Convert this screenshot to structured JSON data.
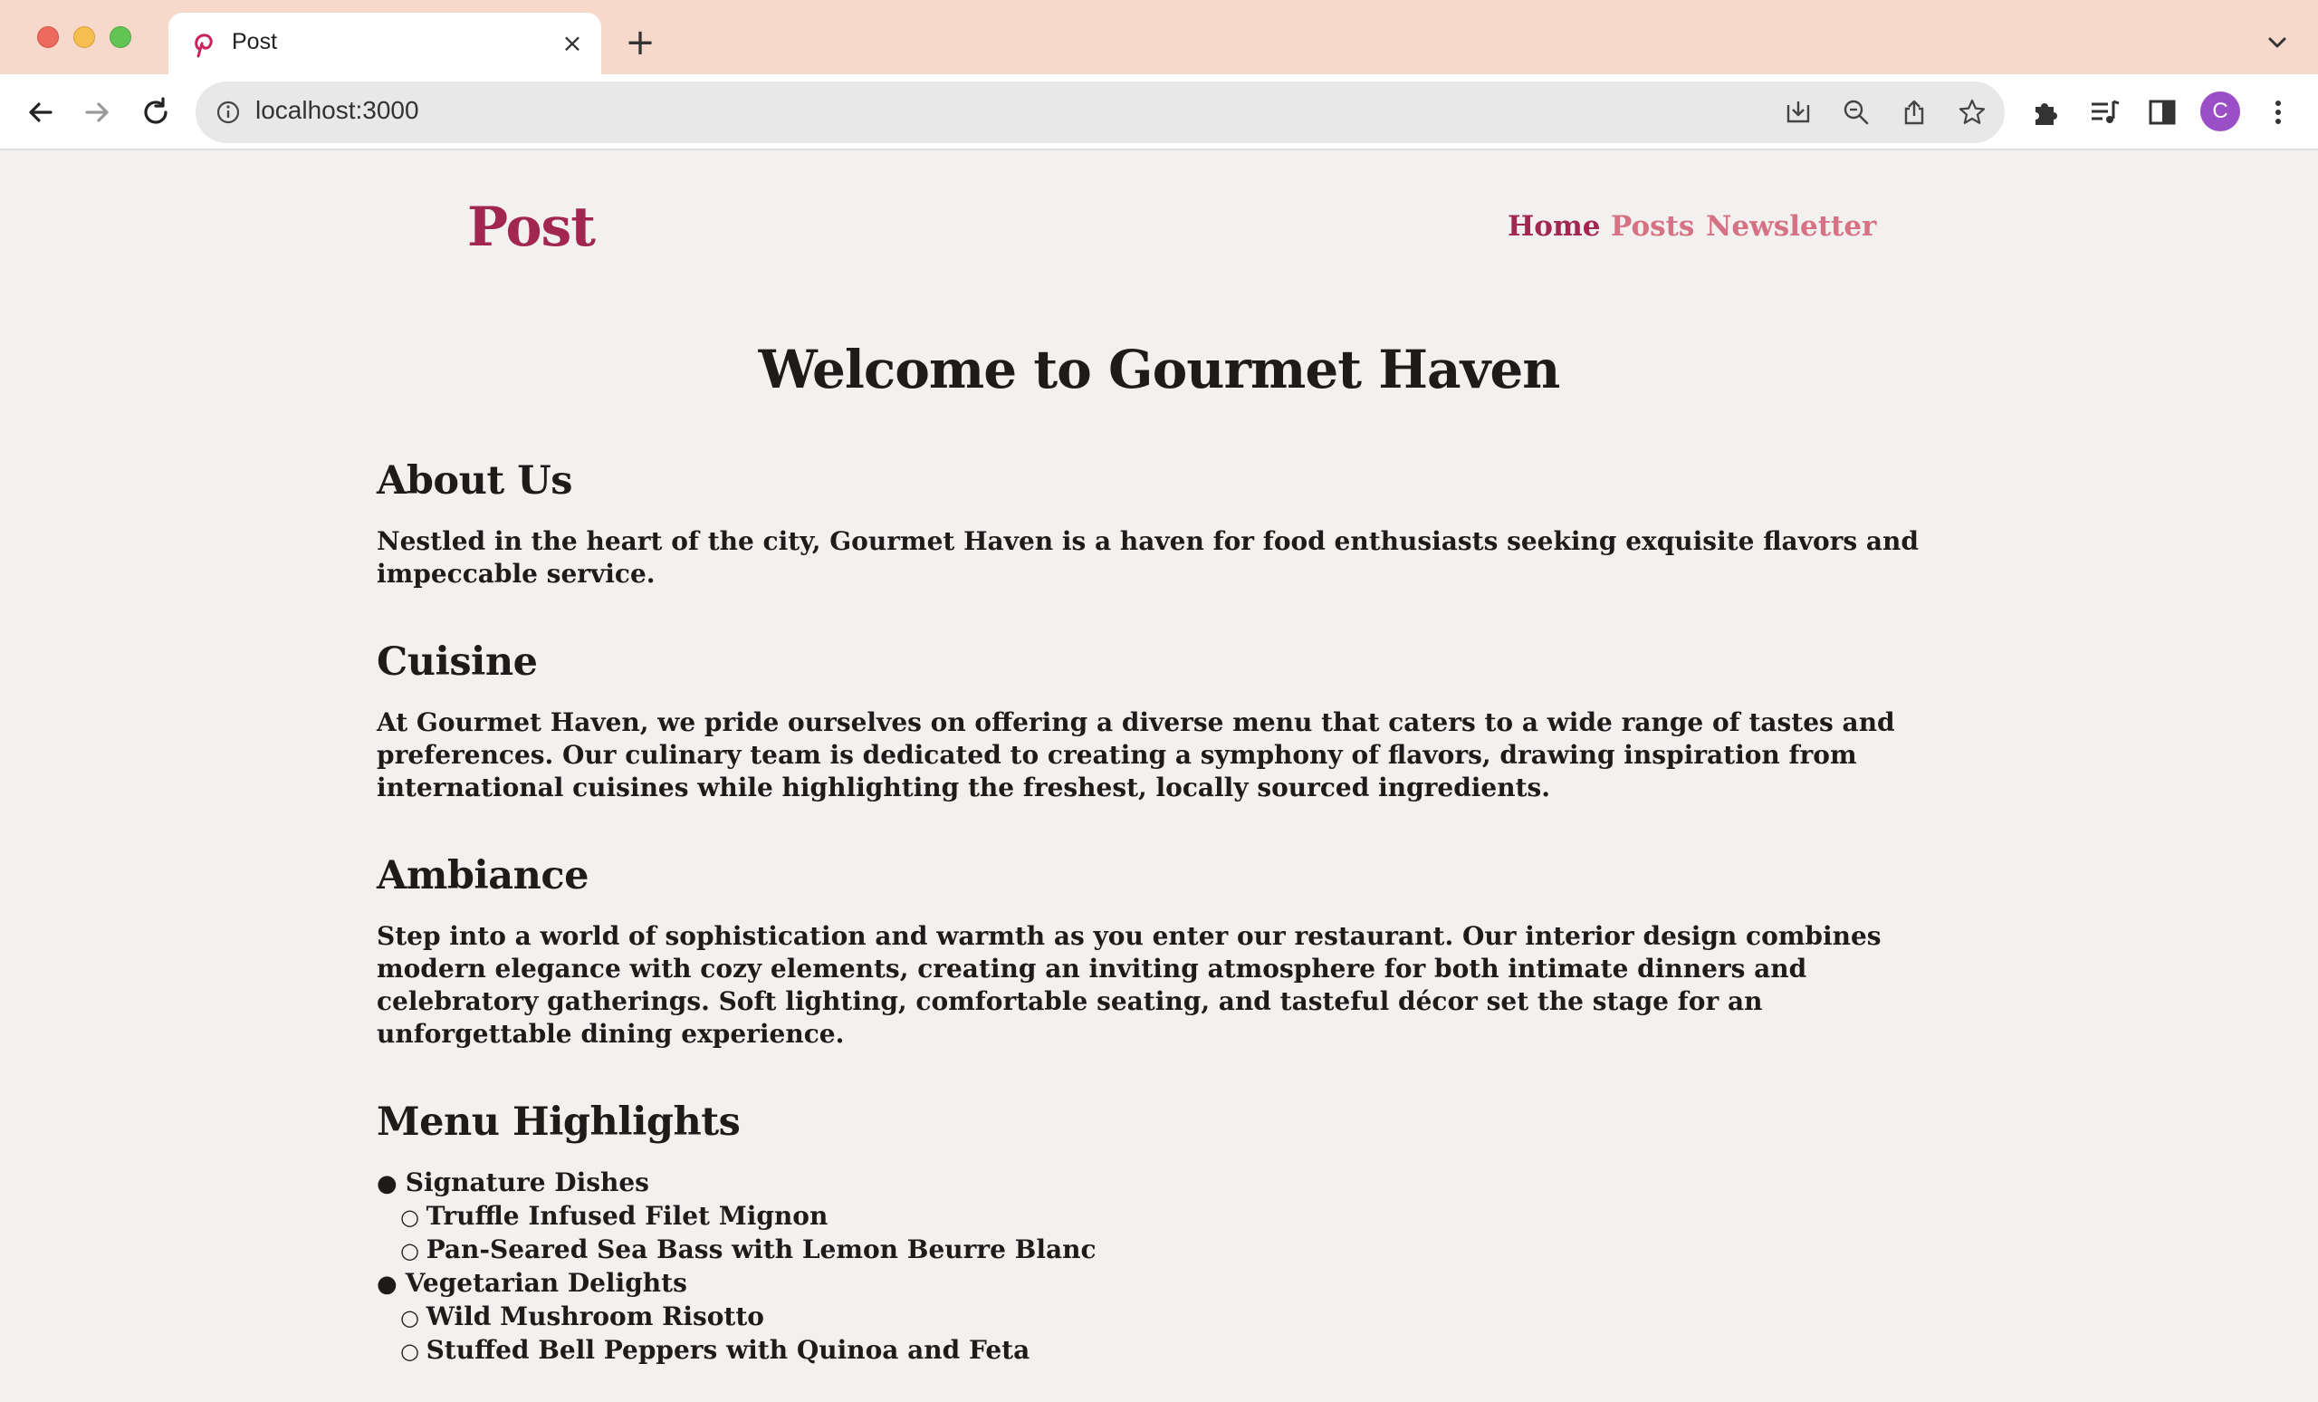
{
  "browser": {
    "tab_title": "Post",
    "tab_close": "×",
    "new_tab": "+",
    "url": "localhost:3000",
    "avatar_letter": "C"
  },
  "site": {
    "brand": "Post",
    "nav": {
      "home": "Home",
      "posts": "Posts",
      "newsletter": "Newsletter"
    },
    "colors": {
      "accent": "#a12650",
      "accent_light": "#d57284",
      "page_bg": "#f3f1f0",
      "tabstrip_bg": "#f7d9cb"
    }
  },
  "main": {
    "title": "Welcome to Gourmet Haven",
    "about": {
      "heading": "About Us",
      "text": "Nestled in the heart of the city, Gourmet Haven is a haven for food enthusiasts seeking exquisite flavors and impeccable service."
    },
    "cuisine": {
      "heading": "Cuisine",
      "text": "At Gourmet Haven, we pride ourselves on offering a diverse menu that caters to a wide range of tastes and preferences. Our culinary team is dedicated to creating a symphony of flavors, drawing inspiration from international cuisines while highlighting the freshest, locally sourced ingredients."
    },
    "ambiance": {
      "heading": "Ambiance",
      "text": "Step into a world of sophistication and warmth as you enter our restaurant. Our interior design combines modern elegance with cozy elements, creating an inviting atmosphere for both intimate dinners and celebratory gatherings. Soft lighting, comfortable seating, and tasteful décor set the stage for an unforgettable dining experience."
    },
    "menu": {
      "heading": "Menu Highlights",
      "categories": [
        {
          "name": "Signature Dishes",
          "items": [
            "Truffle Infused Filet Mignon",
            "Pan-Seared Sea Bass with Lemon Beurre Blanc"
          ]
        },
        {
          "name": "Vegetarian Delights",
          "items": [
            "Wild Mushroom Risotto",
            "Stuffed Bell Peppers with Quinoa and Feta"
          ]
        }
      ]
    }
  }
}
